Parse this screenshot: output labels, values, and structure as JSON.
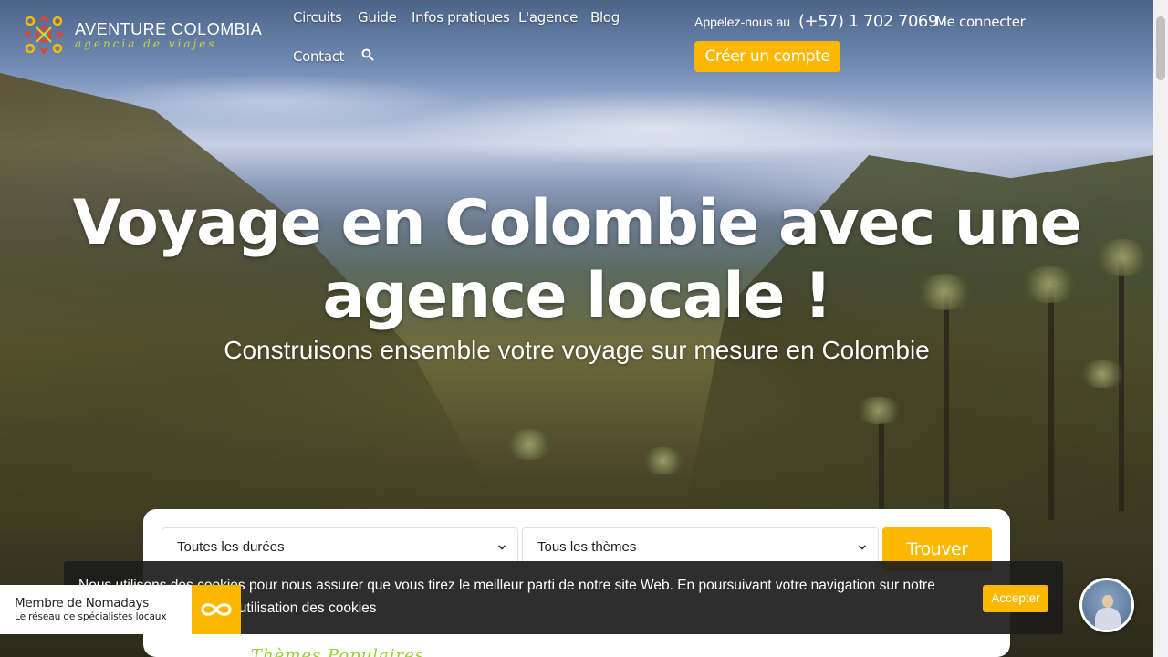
{
  "brand": {
    "name": "AVENTURE COLOMBIA",
    "tagline": "agencia de viajes",
    "colors": {
      "accent": "#fbb800",
      "logo_red": "#e8422a",
      "logo_green": "#c9d43a"
    }
  },
  "nav": {
    "items": [
      "Circuits",
      "Guide",
      "Infos pratiques",
      "L'agence",
      "Blog",
      "Contact"
    ],
    "search_icon": "search-icon"
  },
  "header": {
    "phone_label": "Appelez-nous au",
    "phone_number": "(+57) 1 702 7069",
    "login": "Me connecter",
    "create_account": "Créer un compte"
  },
  "hero": {
    "title": "Voyage en Colombie avec une agence locale !",
    "subtitle": "Construisons ensemble votre voyage sur mesure en Colombie"
  },
  "search": {
    "duration_select": "Toutes les durées",
    "theme_select": "Tous les thèmes",
    "find_button": "Trouver"
  },
  "cookie": {
    "text": "Nous utilisons des cookies pour nous assurer que vous tirez le meilleur parti de notre site Web. En poursuivant votre navigation sur notre site, vous acceptez notre utilisation des cookies",
    "accept": "Accepter"
  },
  "nomadays": {
    "title": "Membre de Nomadays",
    "subtitle": "Le réseau de spécialistes locaux"
  },
  "below": {
    "text": "Thèmes Populaires"
  }
}
